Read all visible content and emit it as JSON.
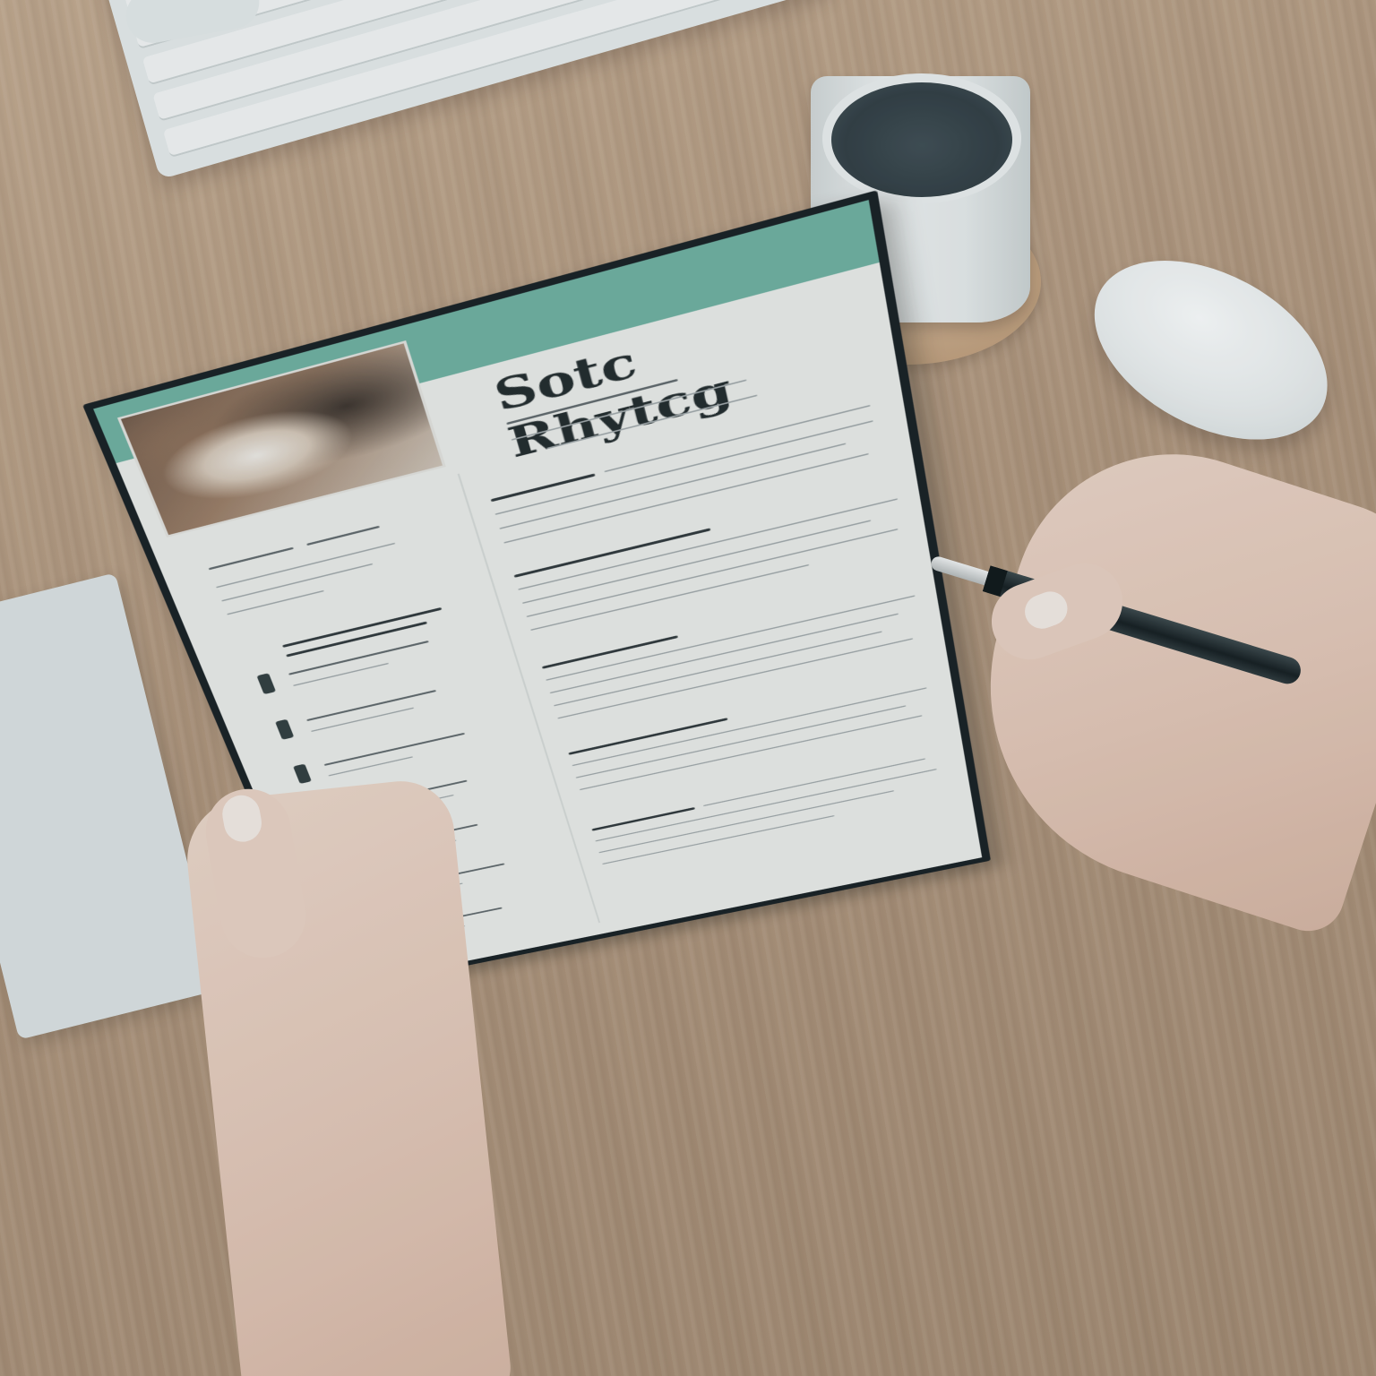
{
  "resume": {
    "banner_text": "",
    "name_heading": "Sotc Rhytcg"
  },
  "colors": {
    "banner": "#6fb0a0",
    "sheet_frame": "#151b1f",
    "paper": "#eeeeea",
    "desk": "#b89c80"
  }
}
